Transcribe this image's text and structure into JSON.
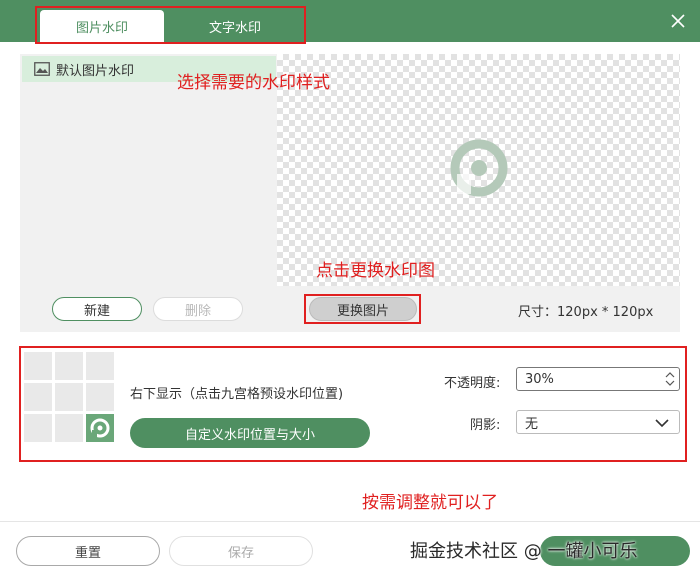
{
  "tabs": [
    {
      "label": "图片水印",
      "active": true
    },
    {
      "label": "文字水印",
      "active": false
    }
  ],
  "watermark_list": {
    "items": [
      "默认图片水印"
    ]
  },
  "preview": {
    "change_image_label": "更换图片",
    "size_label": "尺寸：120px * 120px"
  },
  "list_actions": {
    "new_label": "新建",
    "delete_label": "删除"
  },
  "position": {
    "label": "右下显示（点击九宫格预设水印位置)",
    "selected_cell": 8,
    "custom_button_label": "自定义水印位置与大小"
  },
  "opacity": {
    "label": "不透明度:",
    "value": "30%"
  },
  "shadow": {
    "label": "阴影:",
    "value": "无"
  },
  "footer": {
    "reset_label": "重置",
    "save_label": "保存"
  },
  "annotations": {
    "select_style": "选择需要的水印样式",
    "change_image": "点击更换水印图",
    "adjust": "按需调整就可以了"
  },
  "site_watermark": "掘金技术社区 @ 一罐小可乐",
  "colors": {
    "brand_green": "#4f8f61",
    "annotation_red": "#e02020",
    "selected_cell": "#6aa779"
  }
}
